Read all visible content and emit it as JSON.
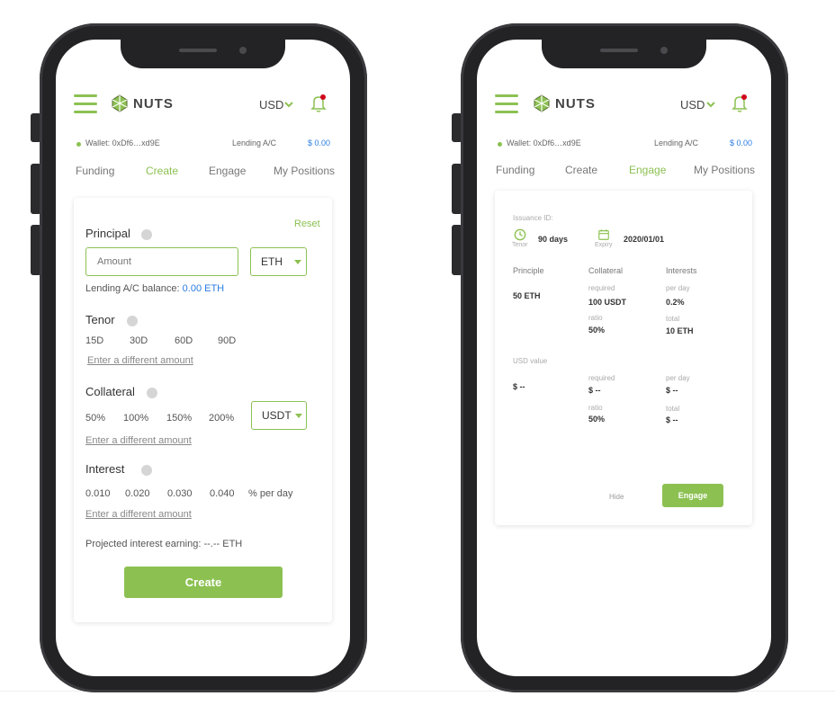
{
  "brand": {
    "name": "NUTS",
    "accent": "#8cc152",
    "link_blue": "#2a7de1"
  },
  "left": {
    "header": {
      "currency": "USD"
    },
    "wallet": {
      "label": "Wallet: 0xDf6…xd9E",
      "account_label": "Lending A/C",
      "account_value": "$ 0.00"
    },
    "tabs": [
      "Funding",
      "Create",
      "Engage",
      "My Positions"
    ],
    "active_tab": "Create",
    "form": {
      "reset": "Reset",
      "principal_label": "Principal",
      "amount_placeholder": "Amount",
      "token": "ETH",
      "balance_label": "Lending A/C balance:",
      "balance_value": "0.00 ETH",
      "tenor_label": "Tenor",
      "tenor_options": [
        "15D",
        "30D",
        "60D",
        "90D"
      ],
      "different_amount": "Enter a different amount",
      "collateral_label": "Collateral",
      "collateral_options": [
        "50%",
        "100%",
        "150%",
        "200%"
      ],
      "collateral_token": "USDT",
      "interest_label": "Interest",
      "interest_options": [
        "0.010",
        "0.020",
        "0.030",
        "0.040"
      ],
      "interest_unit": "% per day",
      "projected": "Projected interest earning: --.-- ETH",
      "create_button": "Create"
    }
  },
  "right": {
    "header": {
      "currency": "USD"
    },
    "wallet": {
      "label": "Wallet: 0xDf6…xd9E",
      "account_label": "Lending A/C",
      "account_value": "$ 0.00"
    },
    "tabs": [
      "Funding",
      "Create",
      "Engage",
      "My Positions"
    ],
    "active_tab": "Engage",
    "issuance": {
      "id_label": "Issuance ID:",
      "tenor_value": "90 days",
      "tenor_label": "Tenor",
      "expiry_value": "2020/01/01",
      "expiry_label": "Expiry",
      "col_principle": "Principle",
      "col_collateral": "Collateral",
      "col_interests": "Interests",
      "principle_value": "50 ETH",
      "required_label": "required",
      "required_value": "100 USDT",
      "ratio_label": "ratio",
      "ratio_value": "50%",
      "per_day_label": "per day",
      "per_day_value": "0.2%",
      "total_label": "total",
      "total_value": "10 ETH",
      "usd_label": "USD value",
      "usd_principle": "$ --",
      "usd_required_label": "required",
      "usd_required": "$ --",
      "usd_ratio_label": "ratio",
      "usd_ratio": "50%",
      "usd_per_day_label": "per day",
      "usd_per_day": "$ --",
      "usd_total_label": "total",
      "usd_total": "$ --",
      "hide_button": "Hide",
      "engage_button": "Engage"
    }
  }
}
